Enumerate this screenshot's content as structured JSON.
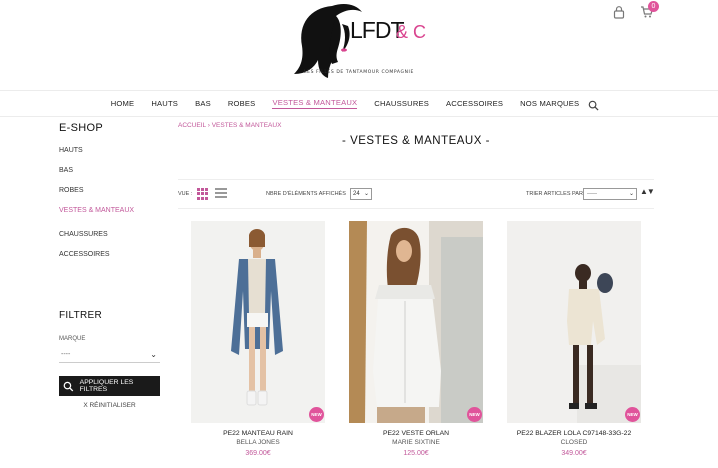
{
  "header": {
    "brand_letters": "LFDT",
    "brand_co": "& CO",
    "tagline": "LES FILLES DE TANTAMOUR COMPAGNIE",
    "cart_count": "0",
    "icons": [
      "lock-icon",
      "cart-icon"
    ]
  },
  "nav": {
    "items": [
      {
        "label": "HOME"
      },
      {
        "label": "HAUTS"
      },
      {
        "label": "BAS"
      },
      {
        "label": "ROBES"
      },
      {
        "label": "VESTES & MANTEAUX"
      },
      {
        "label": "CHAUSSURES"
      },
      {
        "label": "ACCESSOIRES"
      },
      {
        "label": "NOS MARQUES"
      }
    ],
    "active": "VESTES & MANTEAUX"
  },
  "sidebar": {
    "title": "E-SHOP",
    "items": [
      {
        "label": "HAUTS"
      },
      {
        "label": "BAS"
      },
      {
        "label": "ROBES"
      },
      {
        "label": "VESTES & MANTEAUX"
      },
      {
        "label": "CHAUSSURES"
      },
      {
        "label": "ACCESSOIRES"
      }
    ],
    "filter_title": "FILTRER",
    "filter_label": "MARQUE",
    "filter_value": "----",
    "apply_label": "APPLIQUER LES FILTRES",
    "reset_label": "X RÉINITIALISER"
  },
  "main": {
    "breadcrumb": "ACCUEIL › VESTES & MANTEAUX",
    "title": "-  VESTES & MANTEAUX  -",
    "toolbar": {
      "view_label": "VUE :",
      "per_page_label": "NBRE D'ÉLÉMENTS AFFICHÉS",
      "per_page_value": "24",
      "sort_label": "TRIER ARTICLES PAR",
      "sort_value": "-----"
    }
  },
  "products": [
    {
      "name": "PE22 MANTEAU RAIN",
      "brand": "BELLA JONES",
      "price": "369.00€",
      "badge": "NEW"
    },
    {
      "name": "PE22 VESTE ORLAN",
      "brand": "MARIE SIXTINE",
      "price": "125.00€",
      "badge": "NEW"
    },
    {
      "name": "PE22 BLAZER LOLA C97148-33G-22",
      "brand": "CLOSED",
      "price": "349.00€",
      "badge": "NEW"
    }
  ],
  "colors": {
    "accent": "#c2589a",
    "badge": "#e0549b",
    "button_dark": "#1a1a1a"
  }
}
